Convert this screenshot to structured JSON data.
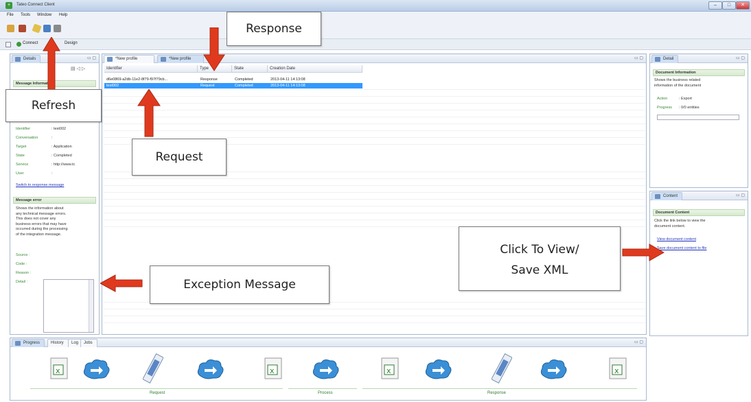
{
  "window": {
    "title": "Tateo Connect Client",
    "min": "–",
    "max": "□",
    "close": "✕"
  },
  "menu": [
    "File",
    "Tools",
    "Window",
    "Help"
  ],
  "perspective": {
    "items": [
      "Connect",
      "Design"
    ]
  },
  "left_panel": {
    "tab_label": "Details",
    "message_info_title": "Message Information",
    "fields": [
      {
        "key": "Identifier",
        "value": ": test002"
      },
      {
        "key": "Conversation",
        "value": ":"
      },
      {
        "key": "Target",
        "value": ": Application"
      },
      {
        "key": "State",
        "value": ": Completed"
      },
      {
        "key": "Service",
        "value": ": http://www.tc"
      },
      {
        "key": "User",
        "value": ":"
      }
    ],
    "switch_link": "Switch to response message",
    "error_title": "Message error",
    "error_desc": [
      "Shows the information about",
      "any technical message errors.",
      "This does not cover any",
      "business errors that may have",
      "occurred during the processing",
      "of the integration message."
    ],
    "error_fields": [
      "Source :",
      "Code :",
      "Reason :",
      "Detail :"
    ]
  },
  "center": {
    "tabs": [
      "*New profile",
      "*New profile"
    ],
    "columns": [
      "Identifier",
      "Type",
      "State",
      "Creation Date"
    ],
    "rows": [
      {
        "identifier": "d6e0869-a2db-11e2-8f79-f97f79cb...",
        "type": "Response",
        "state": "Completed",
        "date": "2013-04-11 14:13:08"
      },
      {
        "identifier": "test002",
        "type": "Request",
        "state": "Completed",
        "date": "2013-04-11 14:13:08"
      }
    ]
  },
  "right_top": {
    "tab_label": "Detail",
    "section_title": "Document Information",
    "desc": [
      "Shows the business related",
      "information of the document"
    ],
    "fields": [
      {
        "key": "Action",
        "value": ": Export"
      },
      {
        "key": "Progress",
        "value": ": 0/0 entities"
      }
    ]
  },
  "right_bottom": {
    "tab_label": "Content",
    "section_title": "Document Content",
    "desc": [
      "Click the link below to view the",
      "document content."
    ],
    "links": [
      "View document content",
      "Save document content to file"
    ]
  },
  "bottom": {
    "tabs": [
      "Progress",
      "History",
      "Log",
      "Jobs"
    ],
    "labels": [
      "Request",
      "Process",
      "Response"
    ]
  },
  "callouts": {
    "response": "Response",
    "refresh": "Refresh",
    "request": "Request",
    "exception": "Exception Message",
    "view_line1": "Click To View/",
    "view_line2": "Save XML"
  },
  "colors": {
    "accent_green": "#3a8a3a",
    "arrow_red": "#e03a1e",
    "selection_blue": "#3399ff"
  }
}
